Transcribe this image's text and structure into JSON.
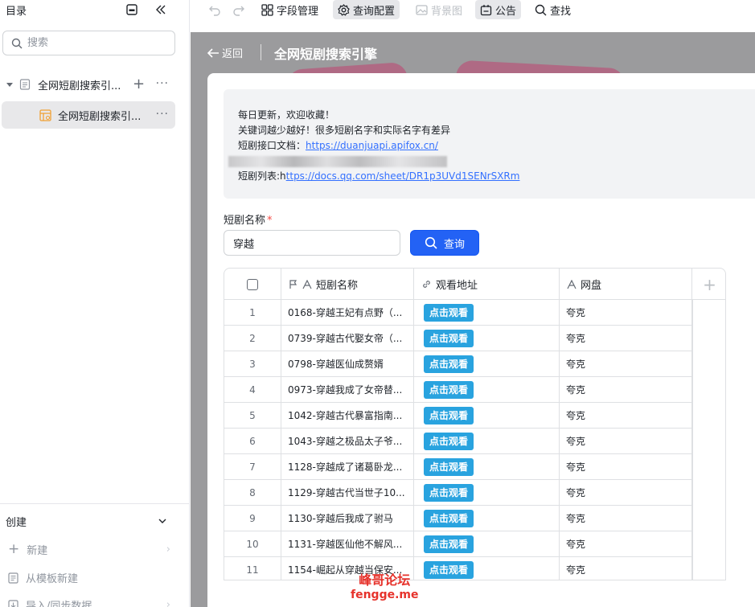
{
  "sidebar": {
    "title": "目录",
    "search_placeholder": "搜索",
    "tree": [
      {
        "label": "全网短剧搜索引..."
      },
      {
        "label": "全网短剧搜索引..."
      }
    ],
    "create": {
      "title": "创建",
      "items": [
        {
          "label": "新建"
        },
        {
          "label": "从模板新建"
        },
        {
          "label": "导入/同步数据"
        }
      ]
    }
  },
  "toolbar": {
    "field_manage": "字段管理",
    "query_config": "查询配置",
    "background": "背景图",
    "notice": "公告",
    "find": "查找"
  },
  "header": {
    "back": "返回",
    "title": "全网短剧搜索引擎"
  },
  "notice": {
    "line1": "每日更新，欢迎收藏！",
    "line2": "关键词越少越好！很多短剧名字和实际名字有差异",
    "line3_prefix": "短剧接口文档：",
    "line3_link": "https://duanjuapi.apifox.cn/",
    "line5_prefix": "短剧列表:h",
    "line5_link": "ttps://docs.qq.com/sheet/DR1p3UVd1SENrSXRm"
  },
  "form": {
    "label": "短剧名称",
    "required_mark": "*",
    "value": "穿越",
    "query_button": "查询"
  },
  "table": {
    "columns": [
      "短剧名称",
      "观看地址",
      "网盘"
    ],
    "rows": [
      {
        "idx": "1",
        "name": "0168-穿越王妃有点野（...",
        "watch": "点击观看",
        "pan": "夸克"
      },
      {
        "idx": "2",
        "name": "0739-穿越古代娶女帝（...",
        "watch": "点击观看",
        "pan": "夸克"
      },
      {
        "idx": "3",
        "name": "0798-穿越医仙成赘婿",
        "watch": "点击观看",
        "pan": "夸克"
      },
      {
        "idx": "4",
        "name": "0973-穿越我成了女帝替...",
        "watch": "点击观看",
        "pan": "夸克"
      },
      {
        "idx": "5",
        "name": "1042-穿越古代暴富指南...",
        "watch": "点击观看",
        "pan": "夸克"
      },
      {
        "idx": "6",
        "name": "1043-穿越之极品太子爷...",
        "watch": "点击观看",
        "pan": "夸克"
      },
      {
        "idx": "7",
        "name": "1128-穿越成了诸葛卧龙...",
        "watch": "点击观看",
        "pan": "夸克"
      },
      {
        "idx": "8",
        "name": "1129-穿越古代当世子10...",
        "watch": "点击观看",
        "pan": "夸克"
      },
      {
        "idx": "9",
        "name": "1130-穿越后我成了驸马",
        "watch": "点击观看",
        "pan": "夸克"
      },
      {
        "idx": "10",
        "name": "1131-穿越医仙他不解风...",
        "watch": "点击观看",
        "pan": "夸克"
      },
      {
        "idx": "11",
        "name": "1154-崛起从穿越当保安...",
        "watch": "点击观看",
        "pan": "夸克"
      }
    ]
  },
  "watermark": {
    "line1": "峰哥论坛",
    "line2": "fengge.me"
  },
  "colors": {
    "accent": "#2362f5",
    "watch_button": "#29a3df",
    "link": "#3370ff",
    "watermark": "#e6322b"
  }
}
